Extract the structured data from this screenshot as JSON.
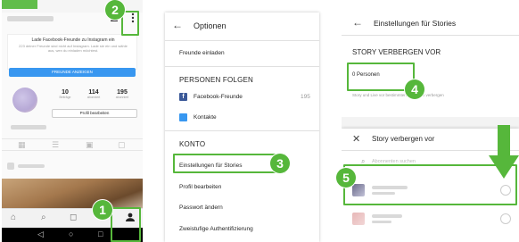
{
  "colors": {
    "accent": "#56b73b",
    "brand": "#3897f0",
    "facebook": "#3b5998"
  },
  "panel1": {
    "connect_title": "Lade Facebook-Freunde zu Instagram ein",
    "connect_sub": "223 deiner Freunde sind nicht auf Instagram. Lade sie ein und wähle aus, wen du einladen möchtest.",
    "fb_button": "FREUNDE ANZEIGEN",
    "stats": [
      {
        "value": "10",
        "label": "Beiträge"
      },
      {
        "value": "114",
        "label": "abonniert"
      },
      {
        "value": "195",
        "label": "abonniert"
      }
    ],
    "edit_profile": "Profil bearbeiten",
    "icons": [
      "add-friend-icon",
      "more-options-icon",
      "grid-icon",
      "list-icon",
      "tagged-icon",
      "home-icon",
      "search-icon",
      "camera-icon",
      "heart-icon",
      "profile-icon"
    ]
  },
  "panel2": {
    "title": "Optionen",
    "invite": "Freunde einladen",
    "follow_header": "PERSONEN FOLGEN",
    "facebook_friends": "Facebook-Freunde",
    "facebook_count": "195",
    "contacts": "Kontakte",
    "account_header": "KONTO",
    "story_settings": "Einstellungen für Stories",
    "edit_profile": "Profil bearbeiten",
    "change_password": "Passwort ändern",
    "two_factor": "Zweistufige Authentifizierung"
  },
  "panel3": {
    "title": "Einstellungen für Stories",
    "section": "STORY VERBERGEN VOR",
    "count": "0 Personen",
    "description": "Story und Live vor bestimmten Personen verbergen",
    "sheet_title": "Story verbergen vor",
    "search_placeholder": "Abonnenten suchen"
  },
  "badges": [
    "1",
    "2",
    "3",
    "4",
    "5"
  ]
}
